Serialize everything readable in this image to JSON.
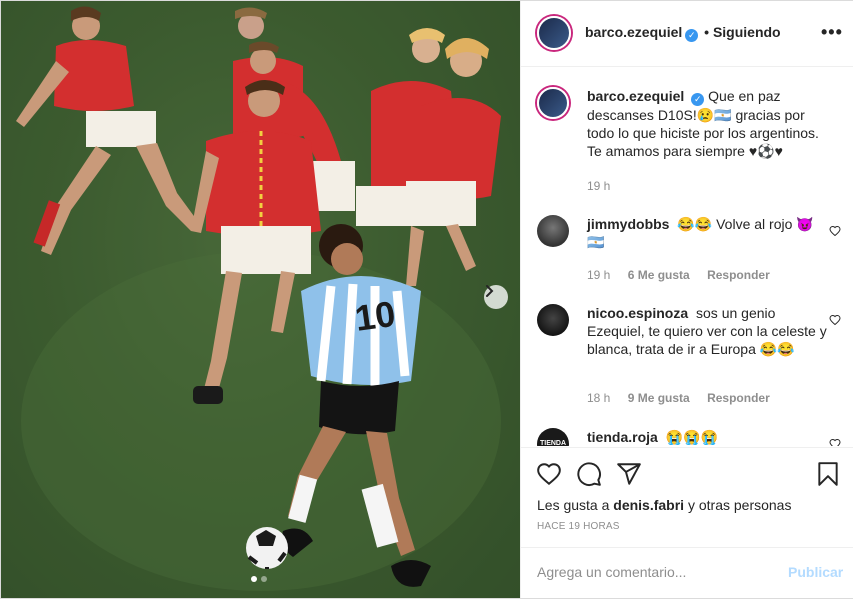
{
  "post": {
    "username": "barco.ezequiel",
    "follow_state": "• Siguiendo",
    "more_label": "•••"
  },
  "caption": {
    "username": "barco.ezequiel",
    "text": "Que en paz descanses D10S!😢🇦🇷 gracias por todo lo que hiciste por los argentinos. Te amamos para siempre ♥⚽♥",
    "time": "19 h"
  },
  "comments": [
    {
      "username": "jimmydobbs",
      "text": "😂😂 Volve al rojo 😈 🇦🇷",
      "time": "19 h",
      "likes": "6 Me gusta",
      "reply": "Responder"
    },
    {
      "username": "nicoo.espinoza",
      "text": "sos un genio Ezequiel, te quiero ver con la celeste y blanca, trata de ir a Europa 😂😂",
      "time": "18 h",
      "likes": "9 Me gusta",
      "reply": "Responder"
    },
    {
      "username": "tienda.roja",
      "avatar_text": "TIENDA",
      "text": "😭😭😭"
    }
  ],
  "likes_line": {
    "prefix": "Les gusta a",
    "user": "denis.fabri",
    "suffix": "y otras personas"
  },
  "timestamp": "HACE 19 HORAS",
  "composer": {
    "placeholder": "Agrega un comentario...",
    "publish": "Publicar"
  },
  "carousel": {
    "slides": 2,
    "active": 1
  },
  "colors": {
    "link_blue": "#3897f0",
    "publish_disabled": "#b3dbff",
    "belgium_red": "#d32f2f",
    "argentina_sky": "#8fc1ea"
  },
  "icons": [
    "heart-icon",
    "comment-icon",
    "share-icon",
    "bookmark-icon",
    "verified-icon",
    "chevron-right-icon",
    "more-icon"
  ]
}
